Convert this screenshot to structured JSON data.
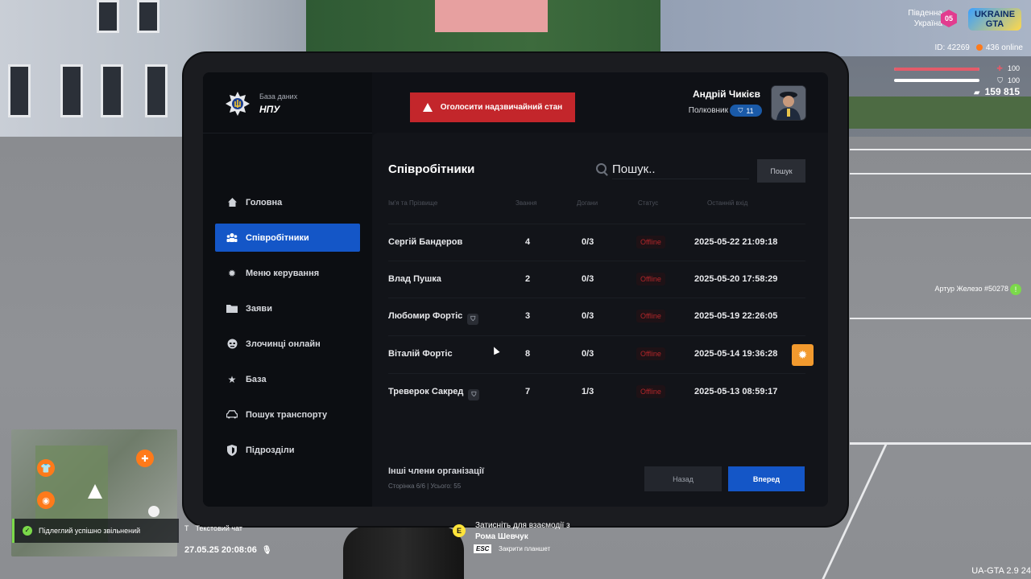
{
  "hud": {
    "region": "Південна\nУкраїна",
    "region_line1": "Південна",
    "region_line2": "Україна",
    "region_badge": "05",
    "logo_line1": "UKRAINE",
    "logo_line2": "GTA",
    "player_id": "ID: 42269",
    "online": "436 online",
    "health": "100",
    "armor": "100",
    "money": "159 815",
    "health_pct": 100,
    "armor_pct": 100,
    "nearby_player": "Артур Железо #50278"
  },
  "brand": {
    "small": "База даних",
    "big": "НПУ"
  },
  "topbar": {
    "alert_label": "Оголосити надзвичайний стан",
    "user_name": "Андрій Чикієв",
    "user_rank": "Полковник",
    "rank_level": "11"
  },
  "nav": [
    {
      "label": "Головна",
      "icon": "home-icon"
    },
    {
      "label": "Співробітники",
      "icon": "users-icon",
      "active": true
    },
    {
      "label": "Меню керування",
      "icon": "gear-icon"
    },
    {
      "label": "Заяви",
      "icon": "folder-icon"
    },
    {
      "label": "Злочинці онлайн",
      "icon": "criminal-icon"
    },
    {
      "label": "База",
      "icon": "star-icon"
    },
    {
      "label": "Пошук транспорту",
      "icon": "car-icon"
    },
    {
      "label": "Підрозділи",
      "icon": "shield-icon"
    }
  ],
  "staff": {
    "title": "Співробітники",
    "search_placeholder": "Пошук..",
    "search_button": "Пошук",
    "columns": [
      "Ім'я та Прізвище",
      "Звання",
      "Догани",
      "Статус",
      "Останній вхід"
    ],
    "rows": [
      {
        "name": "Сергій Бандеров",
        "rank": "4",
        "reprimands": "0/3",
        "status": "Offline",
        "last_login": "2025-05-22 21:09:18",
        "badge": false
      },
      {
        "name": "Влад Пушка",
        "rank": "2",
        "reprimands": "0/3",
        "status": "Offline",
        "last_login": "2025-05-20 17:58:29",
        "badge": false
      },
      {
        "name": "Любомир Фортіс",
        "rank": "3",
        "reprimands": "0/3",
        "status": "Offline",
        "last_login": "2025-05-19 22:26:05",
        "badge": true
      },
      {
        "name": "Віталій Фортіс",
        "rank": "8",
        "reprimands": "0/3",
        "status": "Offline",
        "last_login": "2025-05-14 19:36:28",
        "badge": false
      },
      {
        "name": "Треверок Сакред",
        "rank": "7",
        "reprimands": "1/3",
        "status": "Offline",
        "last_login": "2025-05-13 08:59:17",
        "badge": true
      }
    ],
    "others_label": "Інші члени організації",
    "page_info": "Сторінка 6/6 | Усього: 55",
    "back_label": "Назад",
    "next_label": "Вперед"
  },
  "bottom": {
    "notification": "Підлеглий успішно звільнений",
    "chat_key": "T",
    "chat_label": "Текстовий чат",
    "clock": "27.05.25 20:08:06",
    "interact_key": "E",
    "interact_hint": "Затисніть для взаємодії з",
    "interact_name": "Рома Шевчук",
    "esc_key": "ESC",
    "esc_label": "Закрити планшет",
    "version": "UA-GTA 2.9   24"
  },
  "colors": {
    "accent": "#1456c7",
    "danger": "#c3262b",
    "panel": "#121419",
    "gear": "#f29a2e",
    "ok": "#7bd94a"
  }
}
